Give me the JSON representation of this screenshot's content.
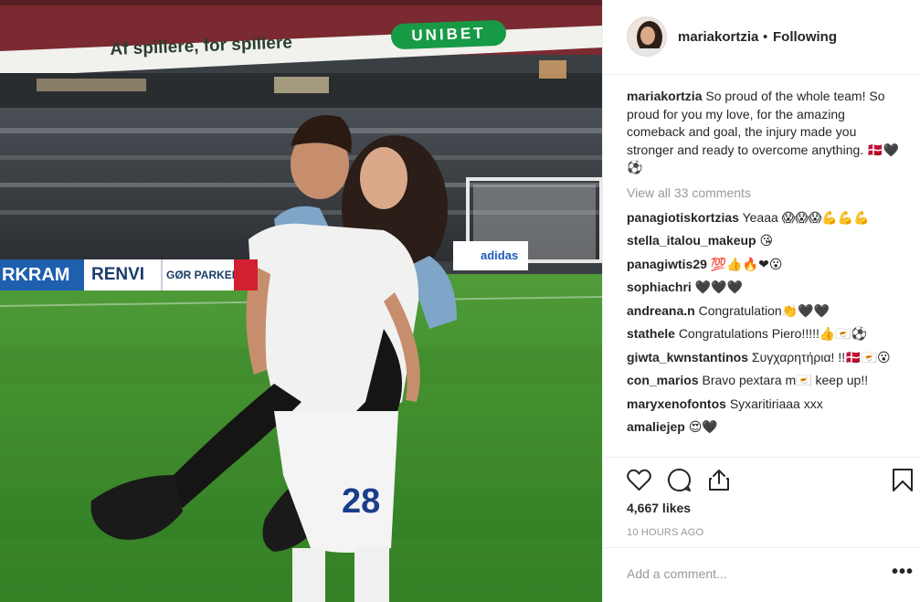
{
  "post": {
    "photo": {
      "banner_text": "Af spillere, for spillere",
      "sponsor_text": "UNIBET",
      "board_texts": [
        "RKRAM",
        "RENVI",
        "GØR PARKEN REN",
        "adidas"
      ],
      "jersey_number": "28"
    }
  },
  "header": {
    "username": "mariakortzia",
    "separator": "•",
    "follow_status": "Following"
  },
  "caption": {
    "username": "mariakortzia",
    "text": "So proud of the whole team! So proud for you my love, for the amazing comeback and goal, the injury made you stronger and ready to overcome anything. 🇩🇰🖤⚽"
  },
  "view_all": "View all 33 comments",
  "comments": [
    {
      "user": "panagiotiskortzias",
      "text": "Yeaaa 😱😱😱💪💪💪"
    },
    {
      "user": "stella_italou_makeup",
      "text": "😘"
    },
    {
      "user": "panagiwtis29",
      "text": "💯👍🔥❤😮"
    },
    {
      "user": "sophiachri",
      "text": "🖤🖤🖤"
    },
    {
      "user": "andreana.n",
      "text": "Congratulation👏🖤🖤"
    },
    {
      "user": "stathele",
      "text": "Congratulations Piero!!!!!👍🇨🇾⚽"
    },
    {
      "user": "giwta_kwnstantinos",
      "text": "Συγχαρητήρια! !!🇩🇰🇨🇾😮"
    },
    {
      "user": "con_marios",
      "text": "Bravo pextara m🇨🇾 keep up!!"
    },
    {
      "user": "maryxenofontos",
      "text": "Syxaritiriaaa xxx"
    },
    {
      "user": "amaliejep",
      "text": "😍🖤"
    }
  ],
  "actions": {
    "like_icon": "heart-icon",
    "comment_icon": "speech-bubble-icon",
    "share_icon": "share-icon",
    "save_icon": "bookmark-icon"
  },
  "likes_text": "4,667 likes",
  "time_ago": "10 HOURS AGO",
  "add_comment_placeholder": "Add a comment...",
  "more_label": "•••",
  "colors": {
    "text": "#262626",
    "muted": "#999999",
    "border": "#efefef",
    "pitch": "#3c8a2c"
  }
}
